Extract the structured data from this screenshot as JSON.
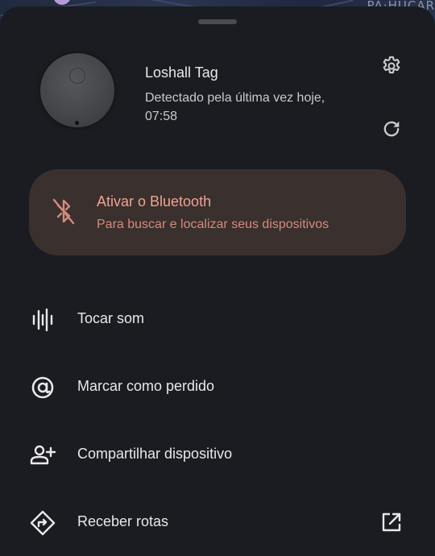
{
  "map": {
    "label": "PA·HUCAR"
  },
  "device": {
    "name": "Loshall Tag",
    "status": "Detectado pela última vez hoje, 07:58"
  },
  "icons": {
    "settings": "gear-icon",
    "refresh": "refresh-icon",
    "bluetooth_disabled": "bluetooth-disabled-icon",
    "play_sound": "sound-wave-icon",
    "mark_lost": "target-at-icon",
    "share": "person-add-icon",
    "directions": "directions-icon",
    "open_external": "open-external-icon"
  },
  "bluetooth_card": {
    "title": "Ativar o Bluetooth",
    "subtitle": "Para buscar e localizar seus dispositivos",
    "colors": {
      "background": "#3a302d",
      "title": "#eda394",
      "subtitle": "#d38b7e"
    }
  },
  "actions": [
    {
      "label": "Tocar som",
      "icon": "sound-wave-icon"
    },
    {
      "label": "Marcar como perdido",
      "icon": "target-at-icon"
    },
    {
      "label": "Compartilhar dispositivo",
      "icon": "person-add-icon"
    },
    {
      "label": "Receber rotas",
      "icon": "directions-icon"
    }
  ],
  "theme": {
    "sheet_background": "#1b1c21",
    "text_primary": "#e8e8ea",
    "text_secondary": "#c9cacd"
  }
}
